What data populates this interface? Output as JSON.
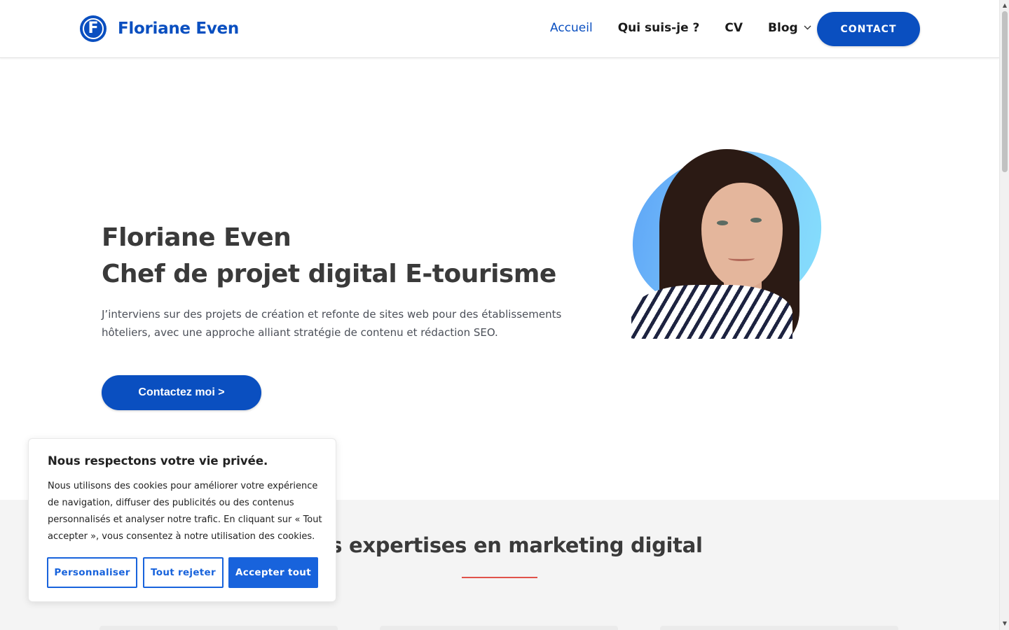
{
  "header": {
    "logo_letter": "F",
    "brand": "Floriane Even",
    "nav": [
      {
        "label": "Accueil",
        "active": true
      },
      {
        "label": "Qui suis-je ?",
        "active": false
      },
      {
        "label": "CV",
        "active": false
      },
      {
        "label": "Blog",
        "active": false,
        "has_dropdown": true
      }
    ],
    "contact_button": "CONTACT"
  },
  "hero": {
    "title_line1": "Floriane Even",
    "title_line2": "Chef de projet digital E-tourisme",
    "description": "J’interviens sur des projets de création et refonte de sites web pour des établissements hôteliers, avec une approche alliant stratégie de contenu et rédaction SEO.",
    "cta_label": "Contactez moi >"
  },
  "expertise": {
    "title": "Mes expertises en marketing digital"
  },
  "cookie_banner": {
    "title": "Nous respectons votre vie privée.",
    "text": "Nous utilisons des cookies pour améliorer votre expérience de navigation, diffuser des publicités ou des contenus personnalisés et analyser notre trafic. En cliquant sur « Tout accepter », vous consentez à notre utilisation des cookies.",
    "customize": "Personnaliser",
    "reject": "Tout rejeter",
    "accept": "Accepter tout"
  },
  "colors": {
    "brand_blue": "#0a4fc0",
    "cookie_blue": "#1863dc",
    "accent_red": "#e0524a",
    "section_bg": "#f4f4f4"
  },
  "icons": {
    "dropdown": "chevron-down-icon",
    "scroll_up": "scroll-up-arrow-icon",
    "scroll_down": "scroll-down-arrow-icon"
  }
}
